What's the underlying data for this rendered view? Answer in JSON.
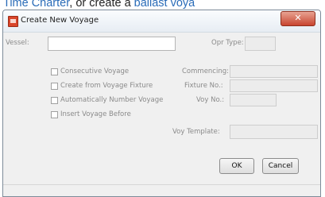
{
  "document": {
    "text_before": "Time Charter",
    "text_middle": ", or create a ",
    "text_link": "ballast voya"
  },
  "dialog": {
    "title": "Create New Voyage",
    "close_glyph": "✕",
    "labels": {
      "vessel": "Vessel:",
      "opr_type": "Opr Type:",
      "commencing": "Commencing:",
      "fixture_no": "Fixture No.:",
      "voy_no": "Voy No.:",
      "voy_template": "Voy Template:"
    },
    "checkboxes": {
      "consecutive": "Consecutive Voyage",
      "from_fixture": "Create from Voyage Fixture",
      "auto_number": "Automatically Number Voyage",
      "insert_before": "Insert Voyage Before"
    },
    "buttons": {
      "ok": "OK",
      "cancel": "Cancel"
    }
  },
  "colors": {
    "link": "#2a6cb8",
    "close_button": "#c8452f"
  }
}
